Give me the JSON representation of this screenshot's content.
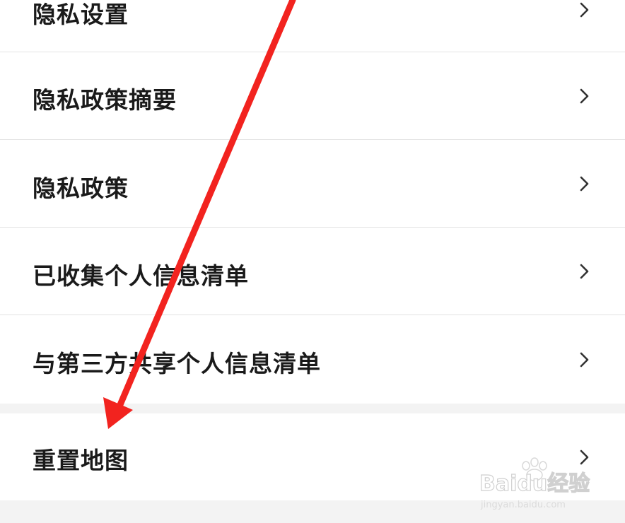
{
  "menu": {
    "items": [
      {
        "label": "隐私设置"
      },
      {
        "label": "隐私政策摘要"
      },
      {
        "label": "隐私政策"
      },
      {
        "label": "已收集个人信息清单"
      },
      {
        "label": "与第三方共享个人信息清单"
      }
    ],
    "reset_map": {
      "label": "重置地图"
    }
  },
  "icons": {
    "chevron": "chevron-right-icon",
    "annotation": "red-arrow-annotation"
  },
  "colors": {
    "background": "#f3f3f3",
    "row": "#ffffff",
    "text": "#1a1a1a",
    "chevron": "#333333",
    "divider": "#e3e3e3",
    "annotation_arrow": "#f2231f"
  },
  "watermark": {
    "brand": "Baidu经验",
    "url": "jingyan.baidu.com"
  }
}
